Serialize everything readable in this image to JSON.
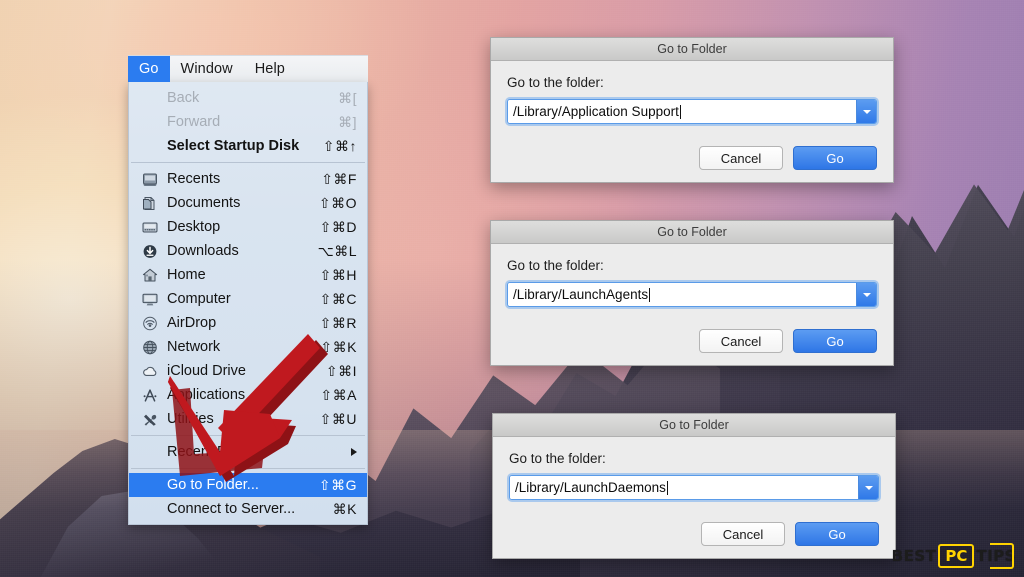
{
  "menubar": {
    "items": [
      {
        "label": "Go",
        "active": true
      },
      {
        "label": "Window",
        "active": false
      },
      {
        "label": "Help",
        "active": false
      }
    ]
  },
  "go_menu": {
    "rows": [
      {
        "label": "Back",
        "key": "⌘[",
        "state": "disabled",
        "icon": "none",
        "bold": false
      },
      {
        "label": "Forward",
        "key": "⌘]",
        "state": "disabled",
        "icon": "none",
        "bold": false
      },
      {
        "label": "Select Startup Disk",
        "key": "⇧⌘↑",
        "state": "normal",
        "icon": "none",
        "bold": true
      },
      {
        "separator": true
      },
      {
        "label": "Recents",
        "key": "⇧⌘F",
        "state": "normal",
        "icon": "recents-icon",
        "bold": false
      },
      {
        "label": "Documents",
        "key": "⇧⌘O",
        "state": "normal",
        "icon": "documents-icon",
        "bold": false
      },
      {
        "label": "Desktop",
        "key": "⇧⌘D",
        "state": "normal",
        "icon": "desktop-icon",
        "bold": false
      },
      {
        "label": "Downloads",
        "key": "⌥⌘L",
        "state": "normal",
        "icon": "downloads-icon",
        "bold": false
      },
      {
        "label": "Home",
        "key": "⇧⌘H",
        "state": "normal",
        "icon": "home-icon",
        "bold": false
      },
      {
        "label": "Computer",
        "key": "⇧⌘C",
        "state": "normal",
        "icon": "computer-icon",
        "bold": false
      },
      {
        "label": "AirDrop",
        "key": "⇧⌘R",
        "state": "normal",
        "icon": "airdrop-icon",
        "bold": false
      },
      {
        "label": "Network",
        "key": "⇧⌘K",
        "state": "normal",
        "icon": "network-icon",
        "bold": false
      },
      {
        "label": "iCloud Drive",
        "key": "⇧⌘I",
        "state": "normal",
        "icon": "icloud-icon",
        "bold": false
      },
      {
        "label": "Applications",
        "key": "⇧⌘A",
        "state": "normal",
        "icon": "applications-icon",
        "bold": false
      },
      {
        "label": "Utilities",
        "key": "⇧⌘U",
        "state": "normal",
        "icon": "utilities-icon",
        "bold": false
      },
      {
        "separator": true
      },
      {
        "label": "Recent Folders",
        "key": "",
        "state": "normal",
        "icon": "none",
        "bold": false,
        "submenu": true
      },
      {
        "separator": true
      },
      {
        "label": "Go to Folder...",
        "key": "⇧⌘G",
        "state": "selected",
        "icon": "none",
        "bold": false
      },
      {
        "label": "Connect to Server...",
        "key": "⌘K",
        "state": "normal",
        "icon": "none",
        "bold": false
      }
    ]
  },
  "dialogs": [
    {
      "title": "Go to Folder",
      "prompt": "Go to the folder:",
      "value": "/Library/Application Support",
      "cancel_label": "Cancel",
      "go_label": "Go"
    },
    {
      "title": "Go to Folder",
      "prompt": "Go to the folder:",
      "value": "/Library/LaunchAgents",
      "cancel_label": "Cancel",
      "go_label": "Go"
    },
    {
      "title": "Go to Folder",
      "prompt": "Go to the folder:",
      "value": "/Library/LaunchDaemons",
      "cancel_label": "Cancel",
      "go_label": "Go"
    }
  ],
  "watermark": {
    "text_left": "BEST",
    "badge": "PC",
    "text_right": "TIPS"
  },
  "colors": {
    "menu_highlight": "#2b7cf0",
    "arrow_red": "#c0191f",
    "arrow_red_dark": "#8e1216",
    "badge_yellow": "#ffd300"
  }
}
